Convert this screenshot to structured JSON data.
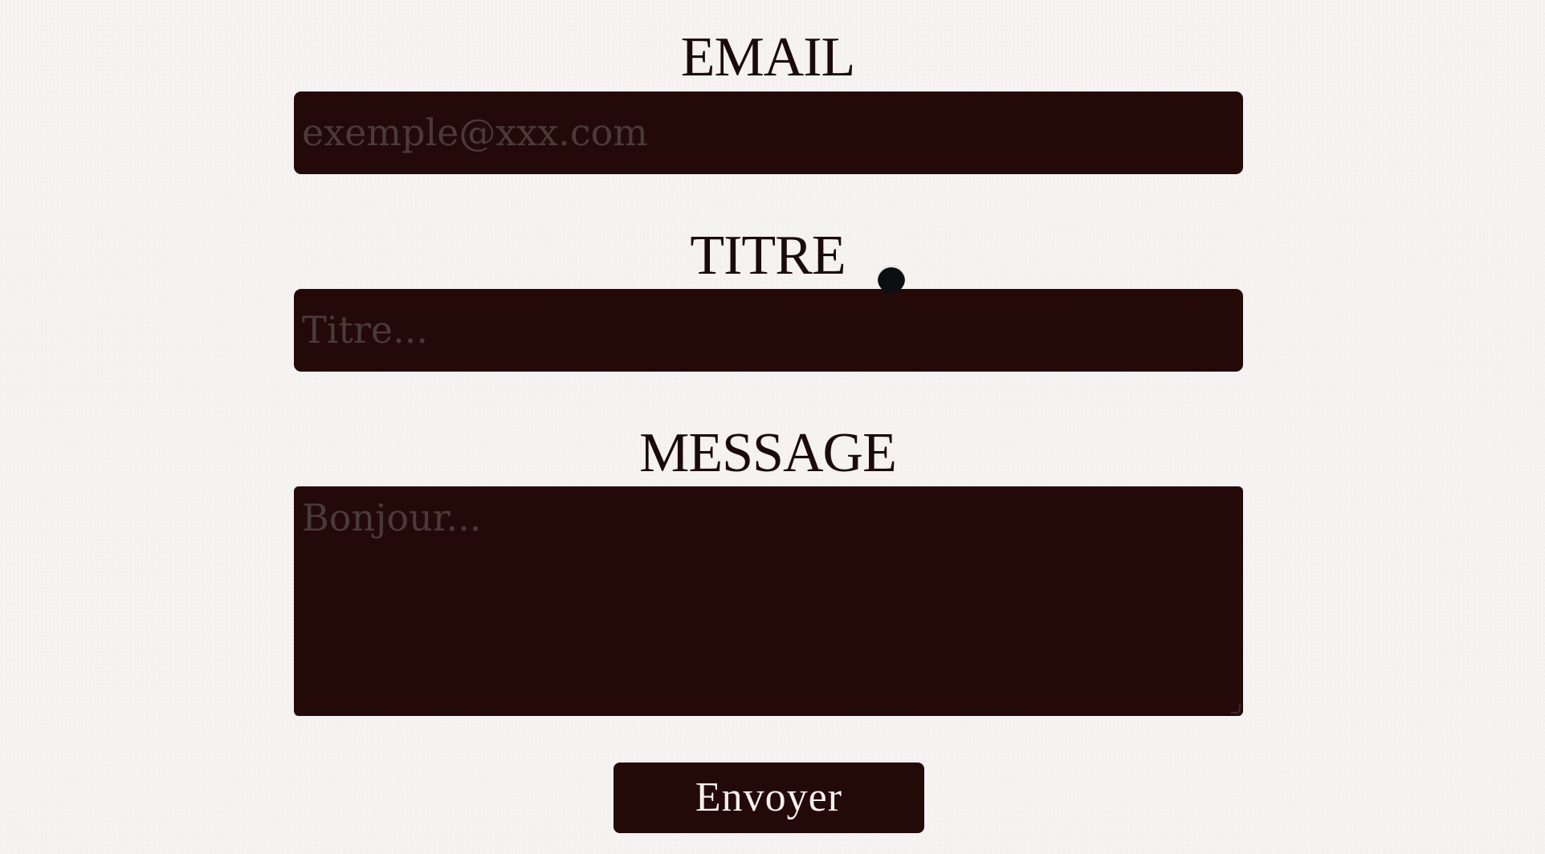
{
  "form": {
    "email": {
      "label": "EMAIL",
      "placeholder": "exemple@xxx.com",
      "value": ""
    },
    "titre": {
      "label": "TITRE",
      "placeholder": "Titre...",
      "value": ""
    },
    "message": {
      "label": "MESSAGE",
      "placeholder": "Bonjour...",
      "value": ""
    },
    "submit_label": "Envoyer"
  },
  "colors": {
    "background": "#f5f2f1",
    "field_background": "#240909",
    "label_text": "#1b0a0c",
    "placeholder_text": "#4a3a3a",
    "button_text": "#f5f0ee"
  },
  "icons": {
    "pointer": "cursor-dot-icon"
  }
}
